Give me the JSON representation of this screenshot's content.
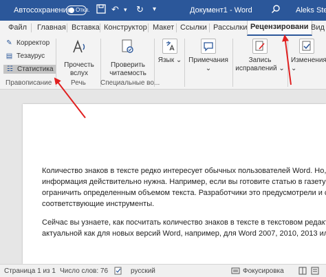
{
  "titlebar": {
    "autosave_label": "Автосохранение",
    "autosave_state": "Откл.",
    "doc_title": "Документ1 - Word",
    "user": "Aleks Step"
  },
  "tabs": [
    "Файл",
    "Главная",
    "Вставка",
    "Конструктор",
    "Макет",
    "Ссылки",
    "Рассылки",
    "Рецензировани",
    "Вид"
  ],
  "active_tab": "Рецензировани",
  "ribbon": {
    "spelling": "Корректор",
    "thesaurus": "Тезаурус",
    "statistics": "Статистика",
    "read_aloud_line1": "Прочесть",
    "read_aloud_line2": "вслух",
    "check_accessibility_line1": "Проверить",
    "check_accessibility_line2": "читаемость",
    "language": "Язык",
    "comments": "Примечания",
    "track_changes_line1": "Запись",
    "track_changes_line2": "исправлений",
    "changes": "Изменения",
    "group_proofing": "Правописание",
    "group_speech": "Речь",
    "group_accessibility": "Специальные во..."
  },
  "document": {
    "para1": [
      "Количество знаков в тексте редко интересует обычных пользователей Word. Но, бы",
      "информация действительно нужна. Например, если вы готовите статью в газету или",
      "ограничить определенным объемом текста. Разработчики это предусмотрели и создал",
      "соответствующие инструменты."
    ],
    "para2": [
      "Сейчас вы узнаете, как посчитать количество знаков в тексте в текстовом редакторе",
      "актуальной как для новых версий Word, например, для Word 2007, 2010, 2013 или 2"
    ]
  },
  "statusbar": {
    "page": "Страница 1 из 1",
    "words": "Число слов: 76",
    "language": "русский",
    "focus": "Фокусировка"
  },
  "colors": {
    "brand": "#2b579a",
    "annotation_arrow": "#e02020"
  }
}
